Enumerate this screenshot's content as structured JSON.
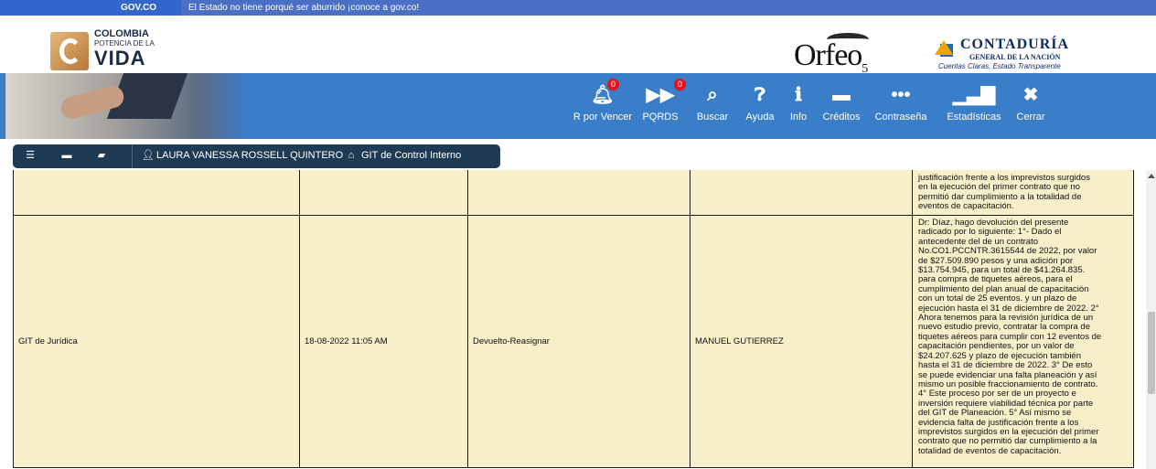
{
  "govbar": {
    "logo": "GOV.CO",
    "message": "El Estado no tiene porqué ser aburrido ¡conoce a gov.co!"
  },
  "header": {
    "colombia_logo": {
      "line1": "COLOMBIA",
      "line2": "POTENCIA DE LA",
      "line3": "VIDA"
    },
    "orfeo_logo": {
      "text": "Orfeo",
      "sub": "5"
    },
    "contaduria_logo": {
      "title": "CONTADURÍA",
      "subtitle": "GENERAL DE LA NACIÓN",
      "tagline": "Cuentas Claras, Estado Transparente"
    }
  },
  "nav": {
    "items": [
      {
        "label": "R por Vencer",
        "icon": "bell-icon",
        "badge": "0"
      },
      {
        "label": "PQRDS",
        "icon": "tags-icon",
        "badge": "0"
      },
      {
        "label": "Buscar",
        "icon": "search-icon"
      },
      {
        "label": "Ayuda",
        "icon": "question-icon"
      },
      {
        "label": "Info",
        "icon": "info-icon"
      },
      {
        "label": "Créditos",
        "icon": "credit-card-icon"
      },
      {
        "label": "Contraseña",
        "icon": "ellipsis-icon"
      },
      {
        "label": "Estadísticas",
        "icon": "bar-chart-icon"
      },
      {
        "label": "Cerrar",
        "icon": "close-icon"
      }
    ]
  },
  "userbar": {
    "user_name": "LAURA VANESSA ROSSELL QUINTERO",
    "department": "GIT de Control Interno"
  },
  "table": {
    "rows": [
      {
        "dependencia": "",
        "fecha": "",
        "transaccion": "",
        "usuario": "",
        "observacion": "justificación frente a los imprevistos surgidos\nen la ejecución del primer contrato que no\npermitió dar cumplimiento a la totalidad de\neventos de capacitación."
      },
      {
        "dependencia": "GIT de Jurídica",
        "fecha": "18-08-2022 11:05 AM",
        "transaccion": "Devuelto-Reasignar",
        "usuario": "MANUEL GUTIERREZ",
        "observacion": "Dr: Díaz, hago devolución del presente\nradicado por lo siguiente: 1°- Dado el\nantecedente del de un contrato\nNo.CO1.PCCNTR.3615544 de 2022, por valor\nde $27.509.890 pesos y una adición por\n$13.754.945, para un total de $41.264.835.\npara compra de tiquetes aéreos, para el\ncumplimiento del plan anual de capacitación\ncon un total de 25 eventos. y un plazo de\nejecución hasta el 31 de diciembre de 2022. 2°\nAhora tenemos para la revisión jurídica de un\nnuevo estudio previo, contratar la compra de\ntiquetes aéreos para cumplir con 12 eventos de\ncapacitación pendientes, por un valor de\n$24.207.625 y plazo de ejecución también\nhasta el 31 de diciembre de 2022. 3° De esto\nse puede evidenciar una falta planeación y así\nmismo un posible fraccionamiento de contrato.\n4° Este proceso por ser de un proyecto e\ninversión requiere viabilidad técnica por parte\ndel GIT de Planeación. 5° Así mismo se\nevidencia falta de justificación frente a los\nimprevistos surgidos en la ejecución del primer\ncontrato que no permitió dar cumplimiento a la\ntotalidad de eventos de capacitación."
      }
    ]
  },
  "colors": {
    "gov_blue": "#3366cc",
    "nav_blue": "#3a7dc9",
    "userbar_bg": "#1f3a55",
    "row_bg": "#f7efca",
    "badge_red": "#e8101a"
  }
}
